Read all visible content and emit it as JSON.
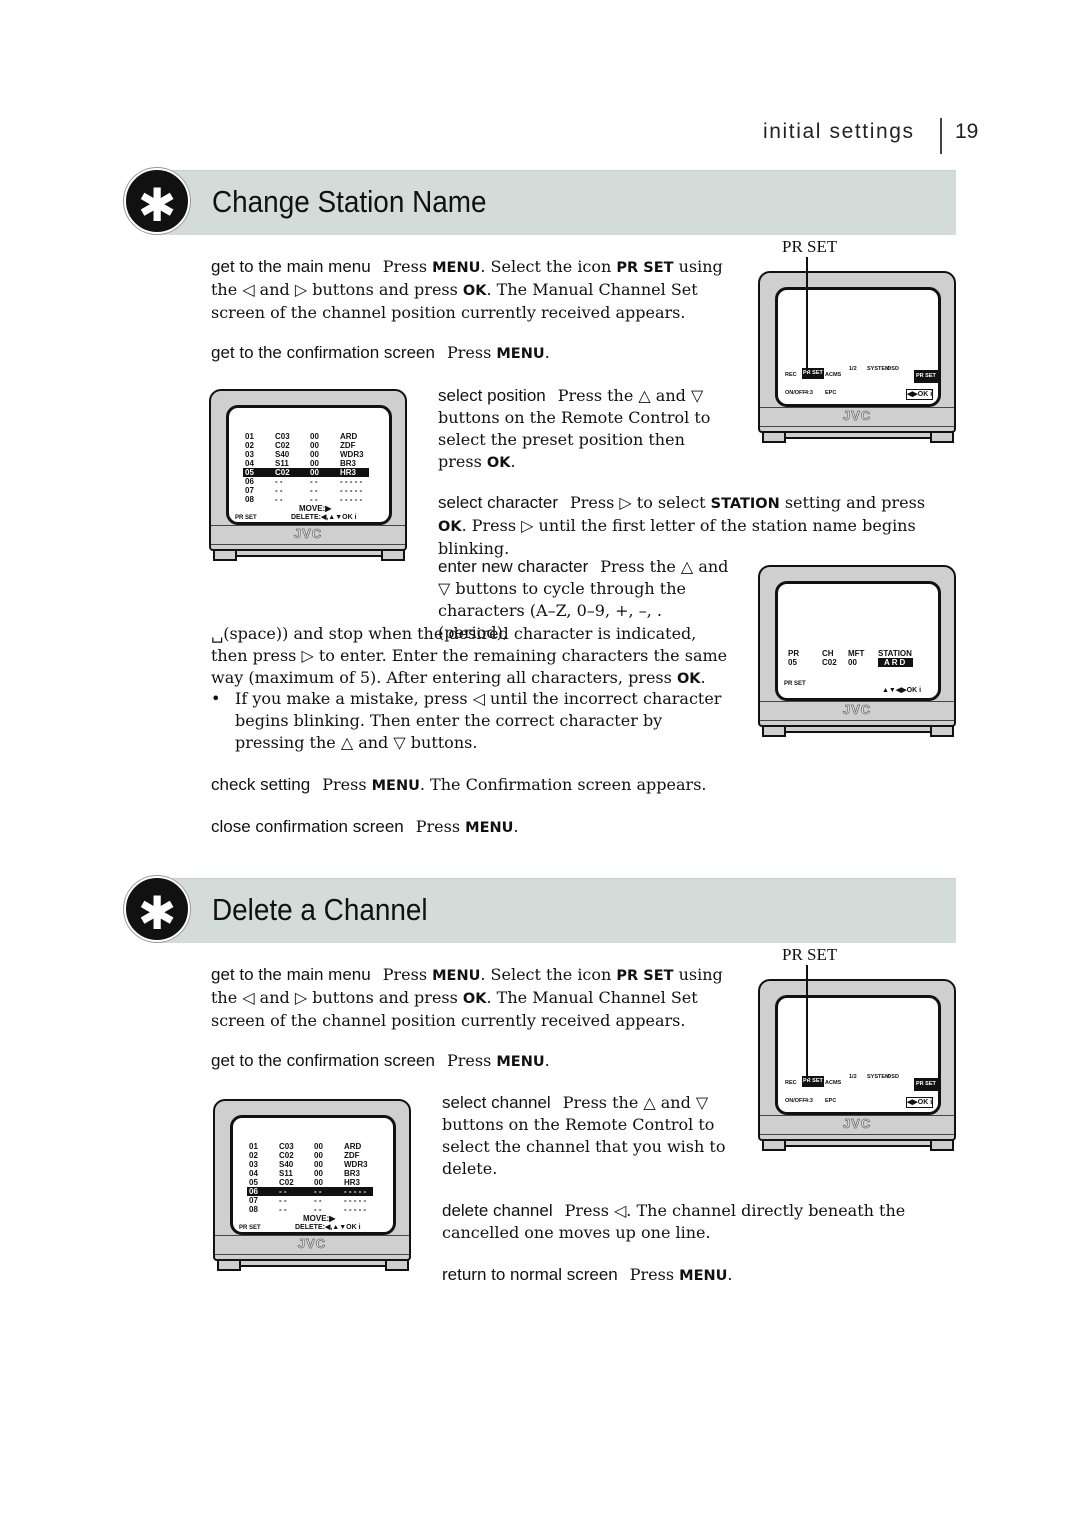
{
  "header": {
    "section": "initial settings",
    "page": "19"
  },
  "sections": [
    {
      "title": "Change Station Name",
      "icon": "asterisk-icon",
      "steps": [
        {
          "label": "get to the main menu",
          "segs": [
            {
              "t": "Press "
            },
            {
              "k": "MENU"
            },
            {
              "t": ". Select the icon "
            },
            {
              "k": "PR SET"
            },
            {
              "t": " using the ◁ and ▷ buttons and press "
            },
            {
              "k": "OK"
            },
            {
              "t": ". The Manual Channel Set screen of the channel position currently received appears."
            }
          ]
        },
        {
          "label": "get to the confirmation screen",
          "segs": [
            {
              "t": "Press "
            },
            {
              "k": "MENU"
            },
            {
              "t": "."
            }
          ]
        },
        {
          "label": "select position",
          "segs": [
            {
              "t": "Press the △ and ▽ buttons on the Remote Control to select the preset position then press "
            },
            {
              "k": "OK"
            },
            {
              "t": "."
            }
          ]
        },
        {
          "label": "select character",
          "segs": [
            {
              "t": "Press ▷ to select "
            },
            {
              "k": "STATION"
            },
            {
              "t": " setting and press "
            },
            {
              "k": "OK"
            },
            {
              "t": ". Press ▷ until the first letter of the station name begins blinking."
            }
          ]
        },
        {
          "label": "enter new character",
          "segs": [
            {
              "t": "Press the △ and ▽ buttons to cycle through the characters (A–Z, 0–9, +, –, . (period),"
            }
          ]
        },
        {
          "label": "",
          "segs": [
            {
              "t": "␣(space)) and stop when the desired character is indicated, then press ▷ to enter. Enter the remaining characters the same way (maximum of 5). After entering all characters, press "
            },
            {
              "k": "OK"
            },
            {
              "t": "."
            }
          ]
        },
        {
          "label": "",
          "segs": [
            {
              "t": "If you make a mistake, press ◁ until the incorrect character begins blinking. Then enter the correct character by pressing the △ and ▽ buttons."
            }
          ]
        },
        {
          "label": "check setting",
          "segs": [
            {
              "t": "Press "
            },
            {
              "k": "MENU"
            },
            {
              "t": ". The Confirmation screen appears."
            }
          ]
        },
        {
          "label": "close confirmation screen",
          "segs": [
            {
              "t": "Press "
            },
            {
              "k": "MENU"
            },
            {
              "t": "."
            }
          ]
        }
      ],
      "pr_set_label": "PR SET"
    },
    {
      "title": "Delete a Channel",
      "icon": "asterisk-icon",
      "steps": [
        {
          "label": "get to the main menu",
          "segs": [
            {
              "t": "Press "
            },
            {
              "k": "MENU"
            },
            {
              "t": ". Select the icon "
            },
            {
              "k": "PR SET"
            },
            {
              "t": " using the ◁ and ▷ buttons and press "
            },
            {
              "k": "OK"
            },
            {
              "t": ". The Manual Channel Set screen of the channel position currently received appears."
            }
          ]
        },
        {
          "label": "get to the confirmation screen",
          "segs": [
            {
              "t": "Press "
            },
            {
              "k": "MENU"
            },
            {
              "t": "."
            }
          ]
        },
        {
          "label": "select channel",
          "segs": [
            {
              "t": "Press the △ and ▽ buttons on the Remote Control to select the channel that you wish to delete."
            }
          ]
        },
        {
          "label": "delete channel",
          "segs": [
            {
              "t": "Press ◁. The channel directly beneath the cancelled one moves up one line."
            }
          ]
        },
        {
          "label": "return to normal screen",
          "segs": [
            {
              "t": "Press "
            },
            {
              "k": "MENU"
            },
            {
              "t": "."
            }
          ]
        }
      ],
      "pr_set_label": "PR SET"
    }
  ],
  "tv_screens": {
    "brand": "JVC",
    "list1": {
      "rows": [
        [
          "01",
          "C03",
          "00",
          "ARD"
        ],
        [
          "02",
          "C02",
          "00",
          "ZDF"
        ],
        [
          "03",
          "S40",
          "00",
          "WDR3"
        ],
        [
          "04",
          "S11",
          "00",
          "BR3"
        ],
        [
          "05",
          "C02",
          "00",
          "HR3"
        ],
        [
          "06",
          "- -",
          "- -",
          "- - - - -"
        ],
        [
          "07",
          "- -",
          "- -",
          "- - - - -"
        ],
        [
          "08",
          "- -",
          "- -",
          "- - - - -"
        ]
      ],
      "highlight": "05",
      "move": "MOVE:▶",
      "delete": "DELETE:◀,▲▼OK i",
      "prset": "PR SET"
    },
    "list2": {
      "rows": [
        [
          "01",
          "C03",
          "00",
          "ARD"
        ],
        [
          "02",
          "C02",
          "00",
          "ZDF"
        ],
        [
          "03",
          "S40",
          "00",
          "WDR3"
        ],
        [
          "04",
          "S11",
          "00",
          "BR3"
        ],
        [
          "05",
          "C02",
          "00",
          "HR3"
        ],
        [
          "06",
          "- -",
          "- -",
          "- - - - -"
        ],
        [
          "07",
          "- -",
          "- -",
          "- - - - -"
        ],
        [
          "08",
          "- -",
          "- -",
          "- - - - -"
        ]
      ],
      "highlight": "06",
      "move": "MOVE:▶",
      "delete": "DELETE:◀,▲▼OK i",
      "prset": "PR SET"
    },
    "menu": {
      "icons": [
        "REC",
        "PR SET",
        "ACMS",
        "1/2",
        "SYSTEM",
        "OSD",
        "ON/OFF",
        "4:3",
        "EPC"
      ],
      "nav": "◀▶OK i",
      "prset": "PR SET"
    },
    "station": {
      "headers": [
        "PR",
        "CH",
        "MFT",
        "STATION"
      ],
      "values": [
        "05",
        "C02",
        "00",
        "ARD"
      ],
      "nav": "▲▼◀▶OK i",
      "prset": "PR SET"
    }
  }
}
